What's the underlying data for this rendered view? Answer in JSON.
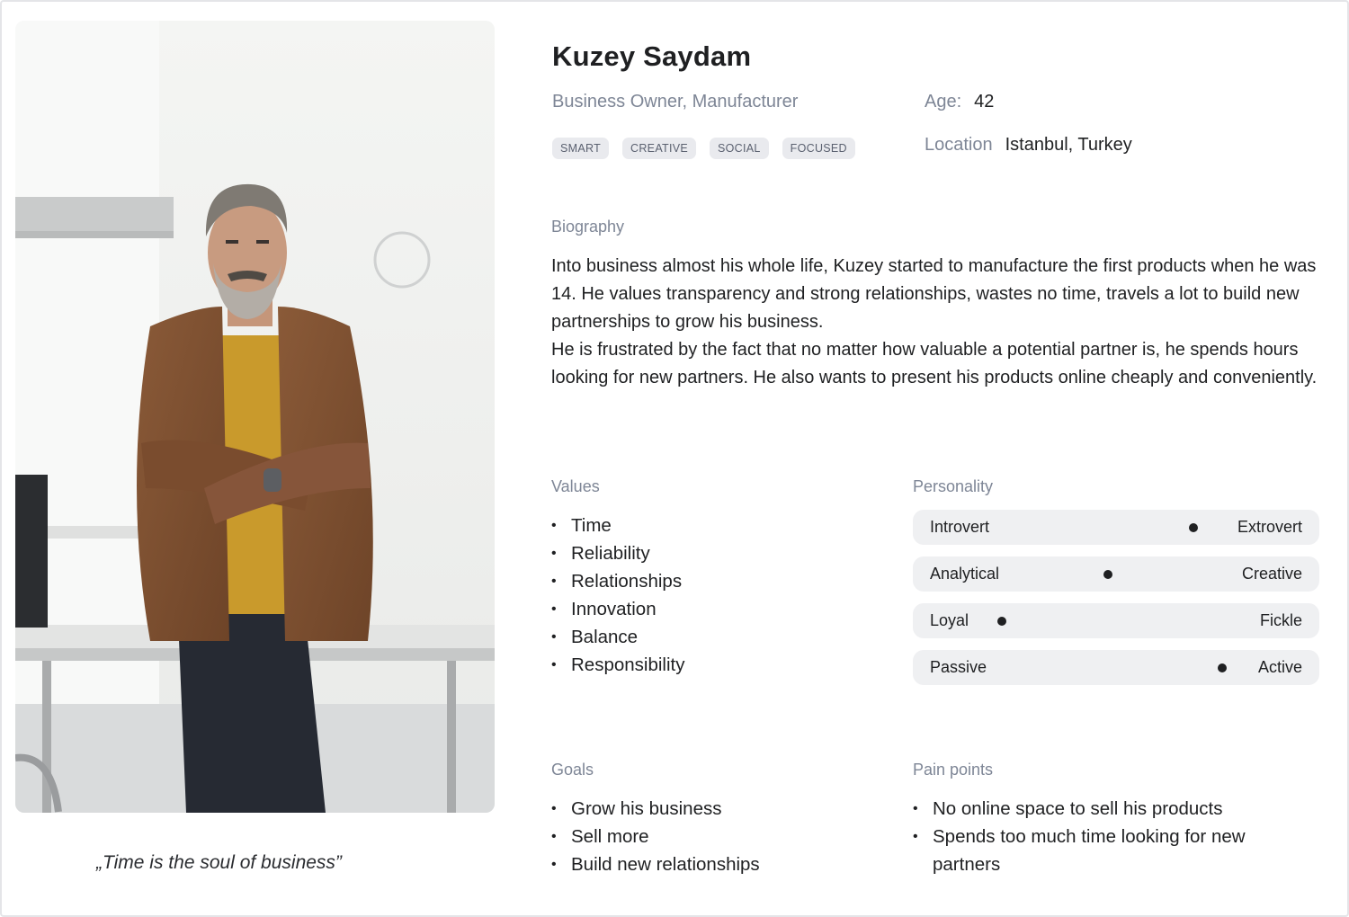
{
  "persona": {
    "name": "Kuzey Saydam",
    "role": "Business Owner, Manufacturer",
    "tags": [
      "SMART",
      "CREATIVE",
      "SOCIAL",
      "FOCUSED"
    ],
    "age_label": "Age:",
    "age": "42",
    "location_label": "Location",
    "location": "Istanbul, Turkey",
    "quote": "„Time is the soul of business”"
  },
  "biography": {
    "title": "Biography",
    "text": "Into business almost his whole life, Kuzey started to manufacture the first products when he was 14. He values transparency and strong relationships, wastes no time, travels a lot to build new partnerships to grow his business.\nHe is frustrated by the fact that no matter how valuable a potential partner is, he spends hours looking for new partners. He also wants to present his products online cheaply and conveniently."
  },
  "values": {
    "title": "Values",
    "items": [
      "Time",
      "Reliability",
      "Relationships",
      "Innovation",
      "Balance",
      "Responsibility"
    ]
  },
  "personality": {
    "title": "Personality",
    "traits": [
      {
        "left": "Introvert",
        "right": "Extrovert",
        "level": 0.69
      },
      {
        "left": "Analytical",
        "right": "Creative",
        "level": 0.48
      },
      {
        "left": "Loyal",
        "right": "Fickle",
        "level": 0.22
      },
      {
        "left": "Passive",
        "right": "Active",
        "level": 0.76
      }
    ]
  },
  "goals": {
    "title": "Goals",
    "items": [
      "Grow his business",
      "Sell more",
      "Build new relationships"
    ]
  },
  "pain_points": {
    "title": "Pain points",
    "items": [
      "No online space to sell his products",
      "Spends too much time looking for new partners"
    ]
  }
}
